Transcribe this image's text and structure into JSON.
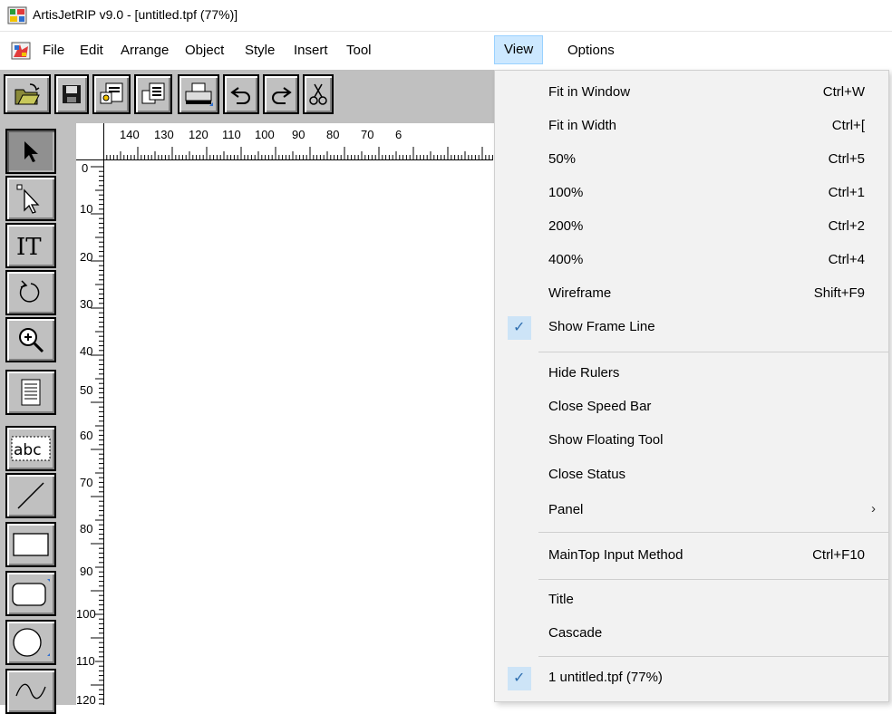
{
  "window": {
    "title": "ArtisJetRIP v9.0 - [untitled.tpf (77%)]"
  },
  "menubar": {
    "items": [
      "File",
      "Edit",
      "Arrange",
      "Object",
      "Style",
      "Insert",
      "Tool",
      "View",
      "Options"
    ],
    "active": "View"
  },
  "toolbar": {
    "buttons": [
      "open-icon",
      "save-icon",
      "import-icon",
      "export-icon",
      "print-icon",
      "undo-icon",
      "redo-icon",
      "cut-icon"
    ]
  },
  "tools": [
    "pointer-icon",
    "node-edit-icon",
    "text-icon",
    "rotate-icon",
    "zoom-icon",
    "page-icon",
    "text-frame-icon",
    "line-icon",
    "rectangle-icon",
    "rounded-rectangle-icon",
    "ellipse-icon",
    "curve-icon"
  ],
  "ruler": {
    "horizontal": [
      "140",
      "130",
      "120",
      "110",
      "100",
      "90",
      "80",
      "70",
      "6"
    ],
    "vertical": [
      "0",
      "10",
      "20",
      "30",
      "40",
      "50",
      "60",
      "70",
      "80",
      "90",
      "100",
      "110",
      "120"
    ]
  },
  "view_menu": {
    "items": [
      {
        "label": "Fit in Window",
        "shortcut": "Ctrl+W"
      },
      {
        "label": "Fit in Width",
        "shortcut": "Ctrl+["
      },
      {
        "label": "50%",
        "shortcut": "Ctrl+5"
      },
      {
        "label": "100%",
        "shortcut": "Ctrl+1"
      },
      {
        "label": "200%",
        "shortcut": "Ctrl+2"
      },
      {
        "label": "400%",
        "shortcut": "Ctrl+4"
      },
      {
        "label": "Wireframe",
        "shortcut": "Shift+F9"
      },
      {
        "label": "Show Frame Line",
        "checked": true
      },
      {
        "label": "Hide Rulers"
      },
      {
        "label": "Close Speed Bar"
      },
      {
        "label": "Show Floating Tool"
      },
      {
        "label": "Close Status"
      },
      {
        "label": "Panel",
        "submenu": true
      },
      {
        "label": "MainTop Input Method",
        "shortcut": "Ctrl+F10"
      },
      {
        "label": "Title"
      },
      {
        "label": "Cascade"
      },
      {
        "label": "1 untitled.tpf (77%)",
        "checked": true
      }
    ],
    "checkmark": "✓",
    "submenu_arrow": "›"
  },
  "colors": {
    "toolbar": "#c0c0c0",
    "menu_highlight": "#cce8ff",
    "menu_bg": "#f2f2f2",
    "check": "#2f6fb0"
  }
}
